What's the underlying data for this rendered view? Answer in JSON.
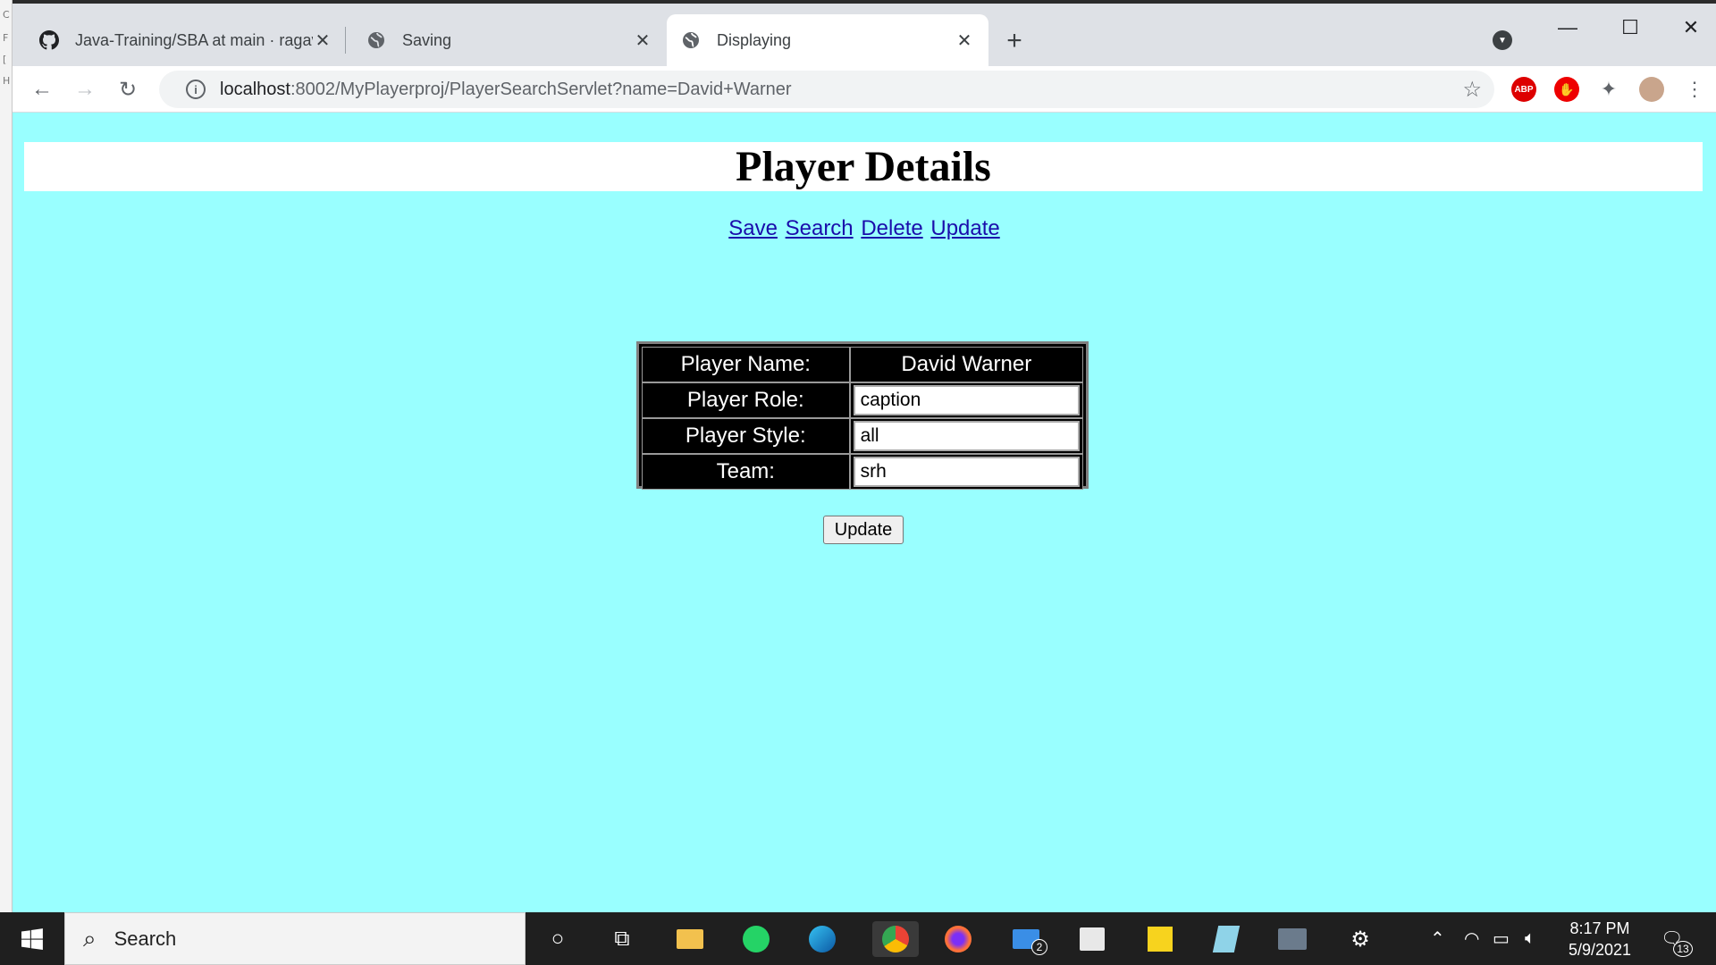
{
  "browser": {
    "tabs": [
      {
        "title": "Java-Training/SBA at main · ragav",
        "icon": "github-icon",
        "active": false
      },
      {
        "title": "Saving",
        "icon": "globe-icon",
        "active": false
      },
      {
        "title": "Displaying",
        "icon": "globe-icon",
        "active": true
      }
    ],
    "address": {
      "host": "localhost",
      "rest": ":8002/MyPlayerproj/PlayerSearchServlet?name=David+Warner"
    },
    "extensions": {
      "abp_label": "ABP"
    }
  },
  "page": {
    "heading": "Player Details",
    "links": [
      "Save",
      "Search",
      "Delete",
      "Update"
    ],
    "table": {
      "rows": [
        {
          "label": "Player Name:",
          "value": "David Warner",
          "editable": false
        },
        {
          "label": "Player Role:",
          "value": "caption",
          "editable": true
        },
        {
          "label": "Player Style:",
          "value": "all",
          "editable": true
        },
        {
          "label": "Team:",
          "value": "srh",
          "editable": true
        }
      ]
    },
    "submit_label": "Update",
    "background_color": "#99ffff"
  },
  "taskbar": {
    "search_placeholder": "Search",
    "mail_badge": "2",
    "time": "8:17 PM",
    "date": "5/9/2021",
    "notification_count": "13"
  }
}
